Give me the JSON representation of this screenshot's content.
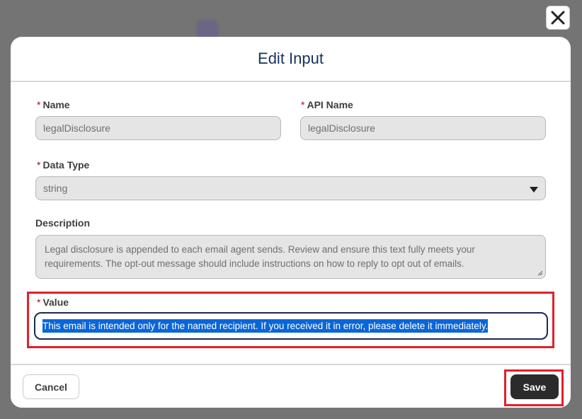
{
  "modal": {
    "title": "Edit Input",
    "required_marker": "*"
  },
  "fields": {
    "name": {
      "label": "Name",
      "value": "legalDisclosure"
    },
    "api_name": {
      "label": "API Name",
      "value": "legalDisclosure"
    },
    "data_type": {
      "label": "Data Type",
      "value": "string"
    },
    "description": {
      "label": "Description",
      "line1": "Legal disclosure is appended to each email agent sends. Review and ensure this text fully meets your",
      "line2": "requirements. The opt-out message should include instructions on how to reply to opt out of emails."
    },
    "value": {
      "label": "Value",
      "text": "This email is intended only for the named recipient. If you received it in error, please delete it immediately."
    }
  },
  "footer": {
    "cancel_label": "Cancel",
    "save_label": "Save"
  },
  "colors": {
    "required": "#ba0517",
    "title": "#16325c",
    "highlight": "#e0202a",
    "selection": "#0a66d8",
    "save_bg": "#2b2b2b"
  },
  "icons": {
    "close": "close-icon",
    "dropdown": "chevron-down-icon"
  }
}
